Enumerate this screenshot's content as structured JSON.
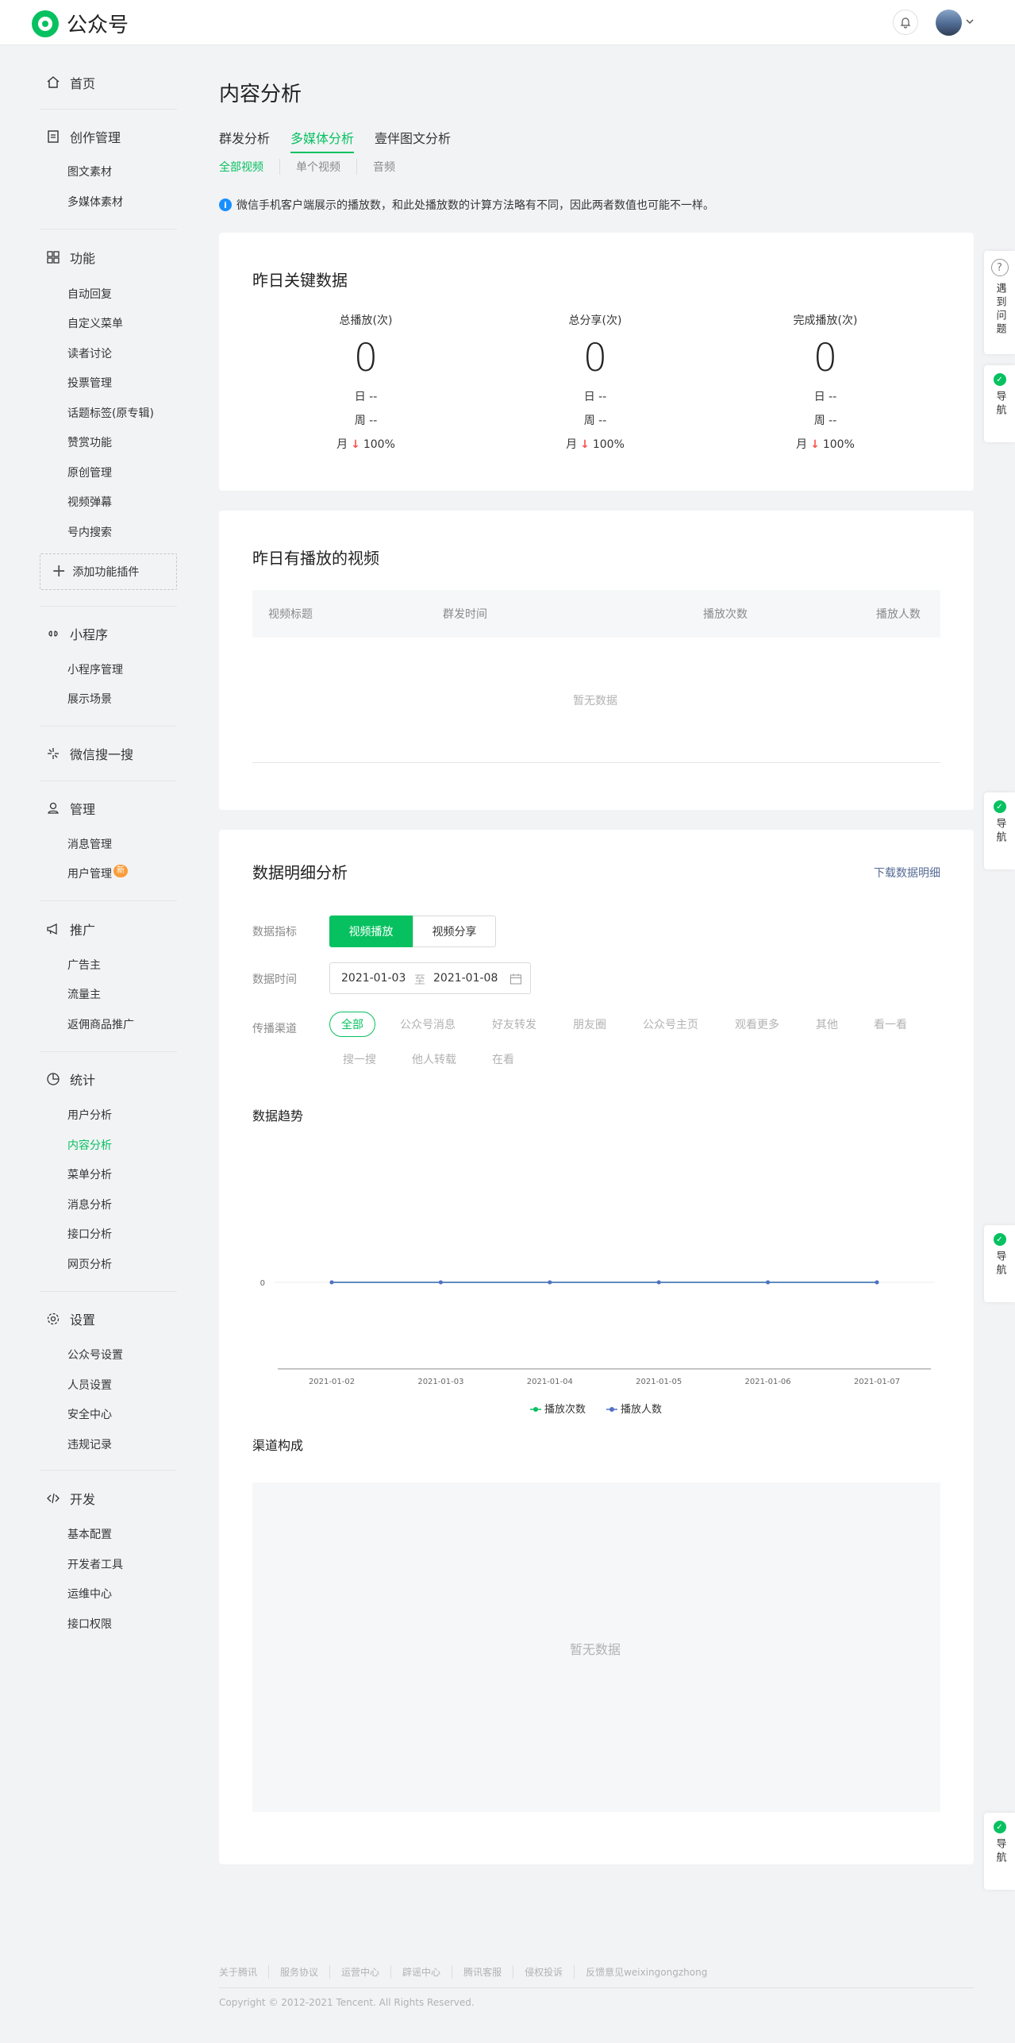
{
  "header": {
    "logo_text": "公众号"
  },
  "sidebar": {
    "home": "首页",
    "creation": {
      "title": "创作管理",
      "items": [
        "图文素材",
        "多媒体素材"
      ]
    },
    "features": {
      "title": "功能",
      "items": [
        "自动回复",
        "自定义菜单",
        "读者讨论",
        "投票管理",
        "话题标签(原专辑)",
        "赞赏功能",
        "原创管理",
        "视频弹幕",
        "号内搜索"
      ]
    },
    "add_plugin": "添加功能插件",
    "miniprogram": {
      "title": "小程序",
      "items": [
        "小程序管理",
        "展示场景"
      ]
    },
    "search": "微信搜一搜",
    "manage": {
      "title": "管理",
      "items": [
        "消息管理",
        "用户管理"
      ],
      "badge": "新"
    },
    "promote": {
      "title": "推广",
      "items": [
        "广告主",
        "流量主",
        "返佣商品推广"
      ]
    },
    "stats": {
      "title": "统计",
      "items": [
        "用户分析",
        "内容分析",
        "菜单分析",
        "消息分析",
        "接口分析",
        "网页分析"
      ]
    },
    "settings": {
      "title": "设置",
      "items": [
        "公众号设置",
        "人员设置",
        "安全中心",
        "违规记录"
      ]
    },
    "dev": {
      "title": "开发",
      "items": [
        "基本配置",
        "开发者工具",
        "运维中心",
        "接口权限"
      ]
    }
  },
  "main": {
    "title": "内容分析",
    "tabs": [
      "群发分析",
      "多媒体分析",
      "壹伴图文分析"
    ],
    "subtabs": [
      "全部视频",
      "单个视频",
      "音频"
    ],
    "notice": "微信手机客户端展示的播放数，和此处播放数的计算方法略有不同，因此两者数值也可能不一样。",
    "key_data": {
      "title": "昨日关键数据",
      "kpis": [
        {
          "label": "总播放(次)",
          "value": "0",
          "day": "日 --",
          "week": "周 --",
          "month_prefix": "月",
          "month_pct": "100%"
        },
        {
          "label": "总分享(次)",
          "value": "0",
          "day": "日 --",
          "week": "周 --",
          "month_prefix": "月",
          "month_pct": "100%"
        },
        {
          "label": "完成播放(次)",
          "value": "0",
          "day": "日 --",
          "week": "周 --",
          "month_prefix": "月",
          "month_pct": "100%"
        }
      ]
    },
    "videos": {
      "title": "昨日有播放的视频",
      "columns": [
        "视频标题",
        "群发时间",
        "播放次数",
        "播放人数"
      ],
      "empty": "暂无数据"
    },
    "detail": {
      "title": "数据明细分析",
      "download": "下载数据明细",
      "metric_label": "数据指标",
      "metric_options": [
        "视频播放",
        "视频分享"
      ],
      "time_label": "数据时间",
      "date_start": "2021-01-03",
      "date_sep": "至",
      "date_end": "2021-01-08",
      "channel_label": "传播渠道",
      "channels": [
        "全部",
        "公众号消息",
        "好友转发",
        "朋友圈",
        "公众号主页",
        "观看更多",
        "其他",
        "看一看",
        "搜一搜",
        "他人转载",
        "在看"
      ],
      "trend_title": "数据趋势",
      "channel_title": "渠道构成",
      "channel_empty": "暂无数据"
    }
  },
  "chart_data": {
    "type": "line",
    "title": "",
    "x": [
      "2021-01-02",
      "2021-01-03",
      "2021-01-04",
      "2021-01-05",
      "2021-01-06",
      "2021-01-07"
    ],
    "series": [
      {
        "name": "播放次数",
        "values": [
          0,
          0,
          0,
          0,
          0,
          0
        ],
        "color": "#07c160"
      },
      {
        "name": "播放人数",
        "values": [
          0,
          0,
          0,
          0,
          0,
          0
        ],
        "color": "#5470c6"
      }
    ],
    "yticks": [
      "0"
    ],
    "legend": "bottom"
  },
  "float": {
    "help": "遇到问题",
    "nav": "导航"
  },
  "footer": {
    "links": [
      "关于腾讯",
      "服务协议",
      "运营中心",
      "辟谣中心",
      "腾讯客服",
      "侵权投诉",
      "反馈意见weixingongzhong"
    ],
    "copyright": "Copyright © 2012-2021 Tencent. All Rights Reserved."
  }
}
